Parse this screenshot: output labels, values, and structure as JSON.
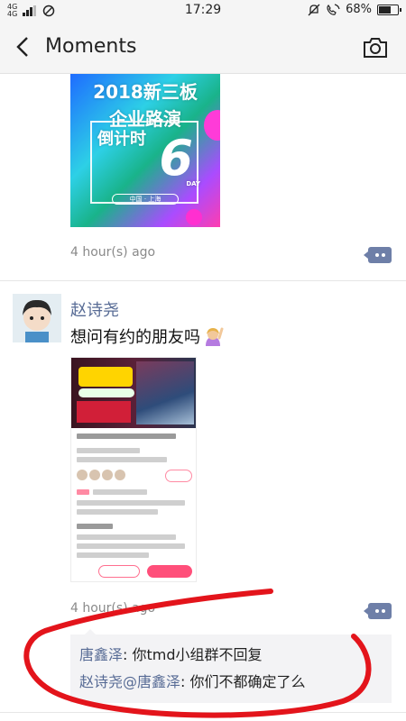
{
  "status_bar": {
    "network_top": "4G",
    "network_bottom": "4G",
    "time": "17:29",
    "battery": "68%",
    "battery_level": 0.68
  },
  "nav": {
    "title": "Moments"
  },
  "posts": [
    {
      "image_lines": [
        "2018新三板",
        "企业路演",
        "倒计时"
      ],
      "image_number": "6",
      "image_day": "DAY",
      "image_pill": "中国 · 上海",
      "time": "4 hour(s) ago"
    },
    {
      "user": "赵诗尧",
      "text": "想问有约的朋友吗",
      "time": "4 hour(s) ago",
      "comments": [
        {
          "author": "唐鑫泽",
          "sep": ": ",
          "text": "你tmd小组群不回复"
        },
        {
          "author": "赵诗尧",
          "at": "@",
          "target": "唐鑫泽",
          "sep": ": ",
          "text": "你们不都确定了么"
        }
      ]
    }
  ],
  "colors": {
    "link_name": "#576b95",
    "annotation_red": "#e3141b",
    "comment_button": "#6e7fa8"
  }
}
